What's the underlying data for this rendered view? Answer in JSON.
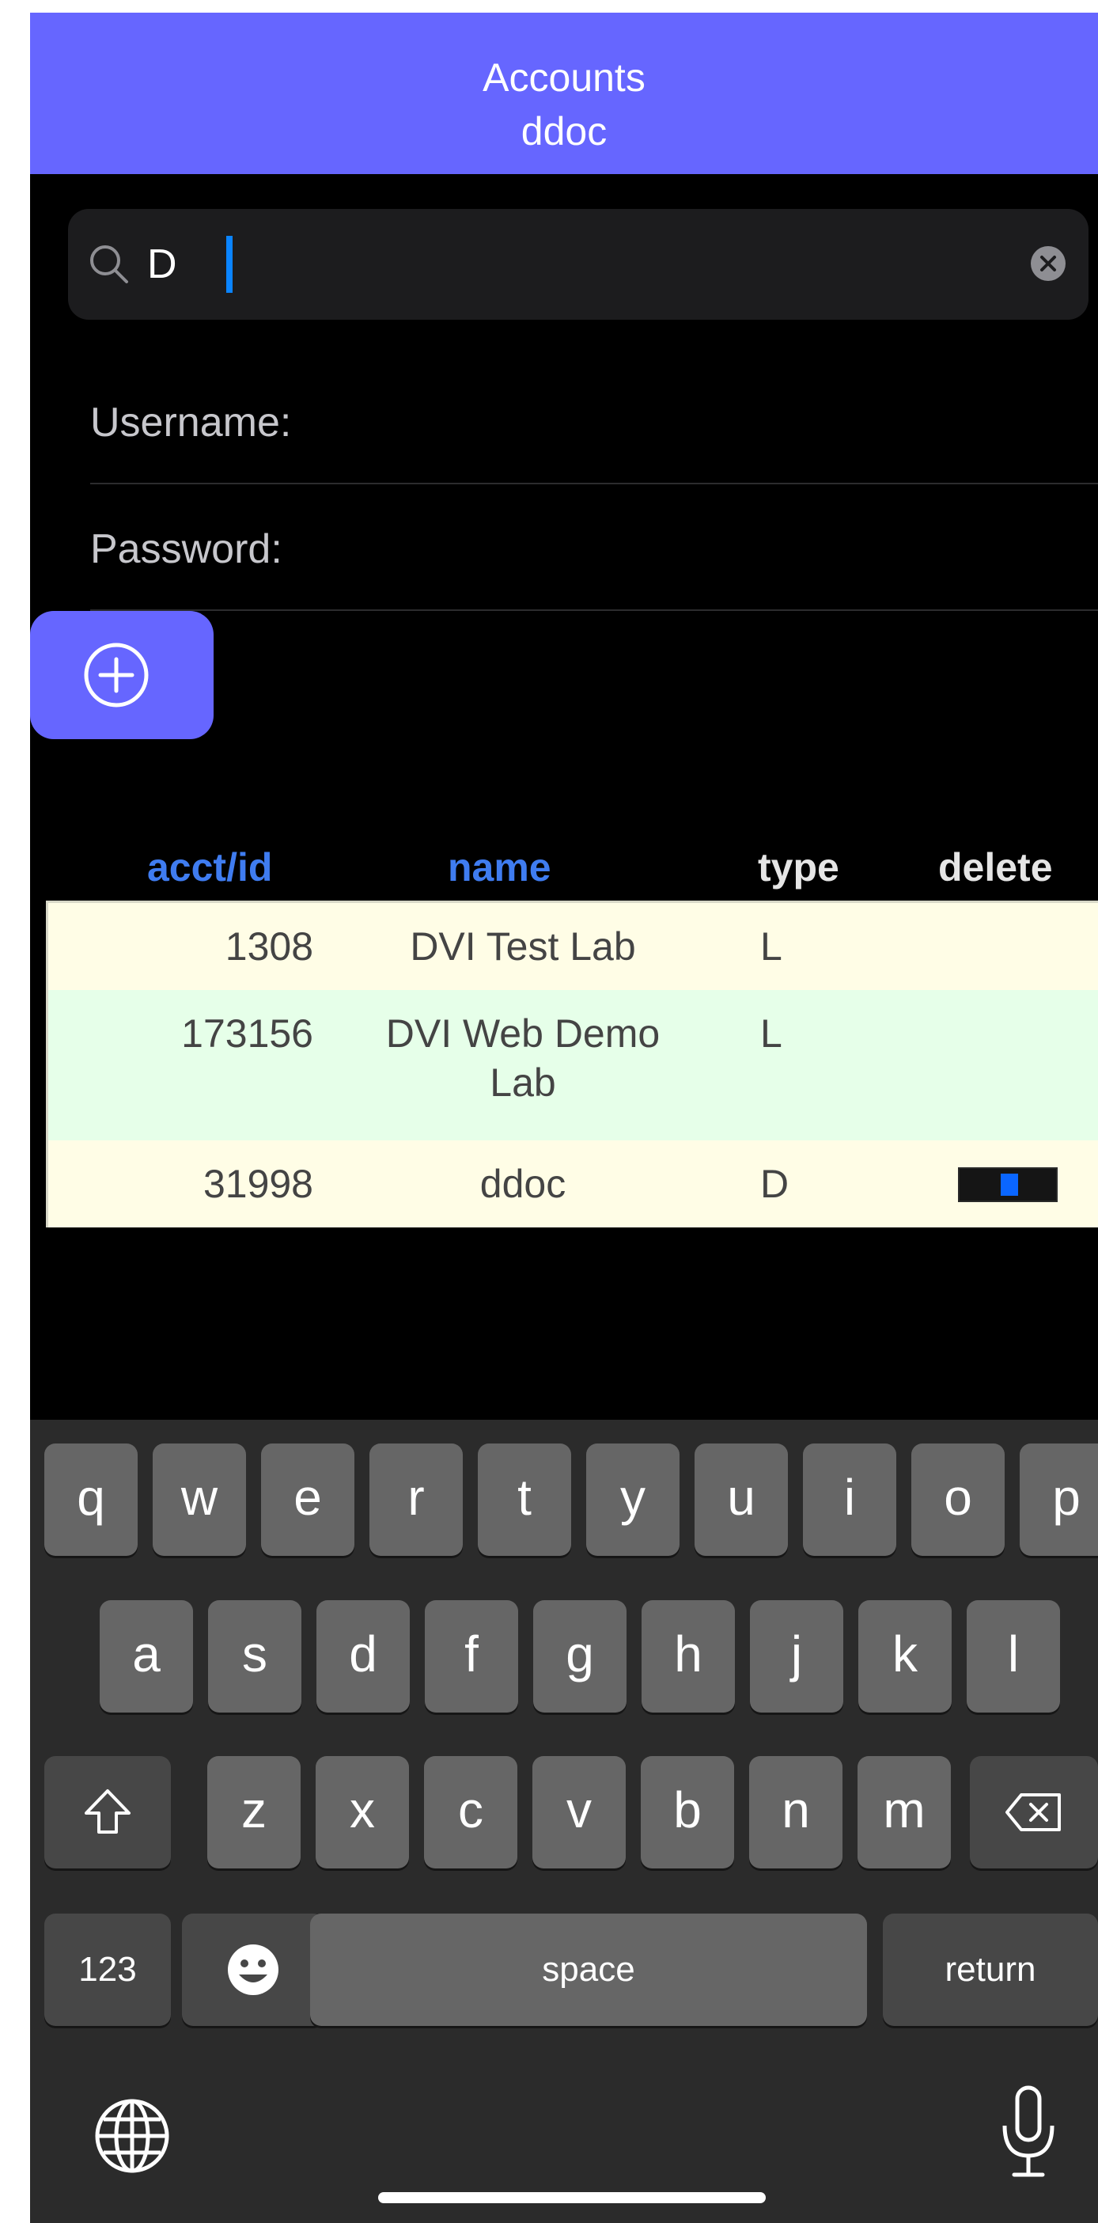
{
  "header": {
    "title": "Accounts",
    "subtitle": "ddoc"
  },
  "search": {
    "value": "D",
    "icon": "magnifying-glass-icon",
    "clear_icon": "clear-circle-icon"
  },
  "form": {
    "username_label": "Username:",
    "password_label": "Password:"
  },
  "add_button": {
    "icon": "plus-circle-icon"
  },
  "table": {
    "columns": [
      "acct/id",
      "name",
      "type",
      "delete"
    ],
    "rows": [
      {
        "acct": "1308",
        "name": "DVI Test Lab",
        "type": "L",
        "has_delete": false
      },
      {
        "acct": "173156",
        "name": "DVI Web Demo Lab",
        "type": "L",
        "has_delete": false
      },
      {
        "acct": "31998",
        "name": "ddoc",
        "type": "D",
        "has_delete": true
      }
    ]
  },
  "keyboard": {
    "row1": [
      "q",
      "w",
      "e",
      "r",
      "t",
      "y",
      "u",
      "i",
      "o",
      "p"
    ],
    "row2": [
      "a",
      "s",
      "d",
      "f",
      "g",
      "h",
      "j",
      "k",
      "l"
    ],
    "row3": [
      "z",
      "x",
      "c",
      "v",
      "b",
      "n",
      "m"
    ],
    "numbers_label": "123",
    "space_label": "space",
    "return_label": "return",
    "shift_icon": "shift-arrow-icon",
    "backspace_icon": "backspace-icon",
    "emoji_icon": "emoji-face-icon",
    "globe_icon": "globe-icon",
    "mic_icon": "microphone-icon"
  },
  "colors": {
    "accent": "#6666ff",
    "link_blue": "#3f7cf0",
    "row_odd": "#fffde6",
    "row_even": "#e6ffe9"
  }
}
